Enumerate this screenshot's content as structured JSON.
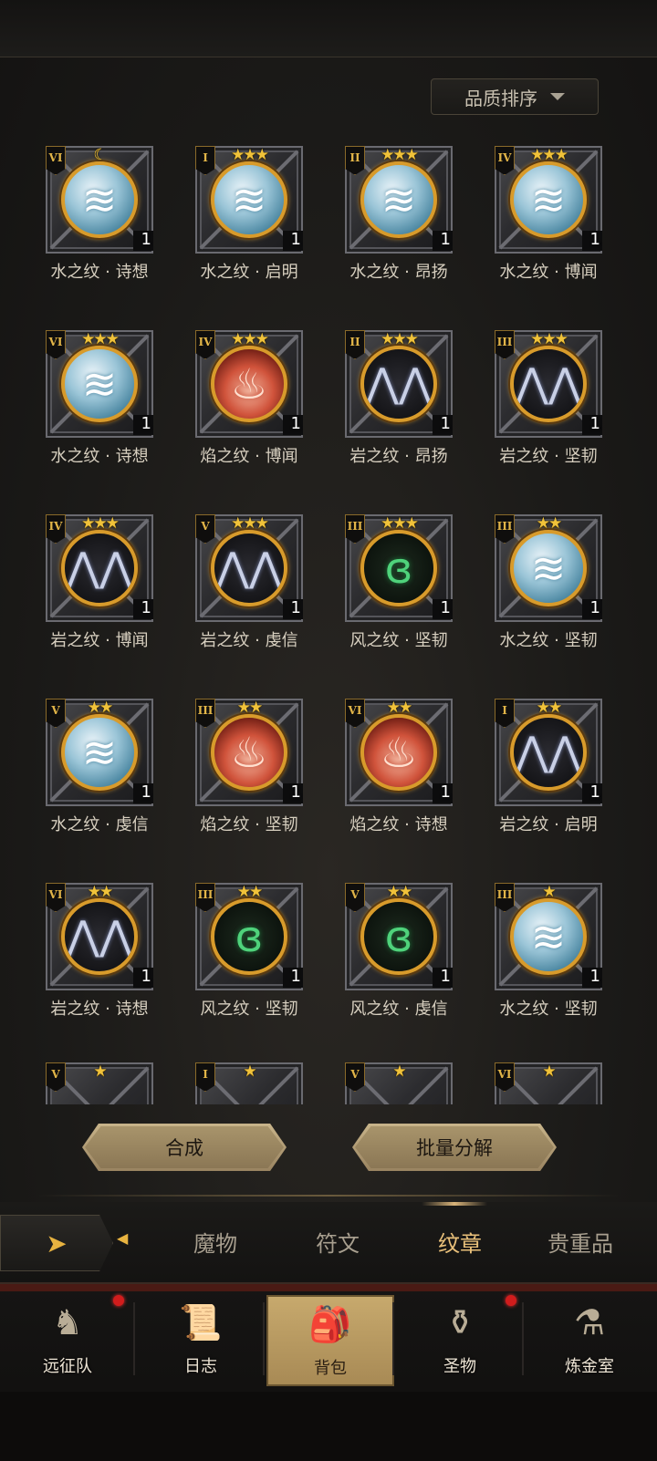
{
  "sort_button": {
    "label": "品质排序"
  },
  "items": [
    {
      "tier": "VI",
      "stars": "☾",
      "element": "water",
      "name": "水之纹 · 诗想",
      "count": "1"
    },
    {
      "tier": "I",
      "stars": "★★★",
      "element": "water",
      "name": "水之纹 · 启明",
      "count": "1"
    },
    {
      "tier": "II",
      "stars": "★★★",
      "element": "water",
      "name": "水之纹 · 昂扬",
      "count": "1"
    },
    {
      "tier": "IV",
      "stars": "★★★",
      "element": "water",
      "name": "水之纹 · 博闻",
      "count": "1"
    },
    {
      "tier": "VI",
      "stars": "★★★",
      "element": "water",
      "name": "水之纹 · 诗想",
      "count": "1"
    },
    {
      "tier": "IV",
      "stars": "★★★",
      "element": "flame",
      "name": "焰之纹 · 博闻",
      "count": "1"
    },
    {
      "tier": "II",
      "stars": "★★★",
      "element": "rock",
      "name": "岩之纹 · 昂扬",
      "count": "1"
    },
    {
      "tier": "III",
      "stars": "★★★",
      "element": "rock",
      "name": "岩之纹 · 坚韧",
      "count": "1"
    },
    {
      "tier": "IV",
      "stars": "★★★",
      "element": "rock",
      "name": "岩之纹 · 博闻",
      "count": "1"
    },
    {
      "tier": "V",
      "stars": "★★★",
      "element": "rock",
      "name": "岩之纹 · 虔信",
      "count": "1"
    },
    {
      "tier": "III",
      "stars": "★★★",
      "element": "wind",
      "name": "风之纹 · 坚韧",
      "count": "1"
    },
    {
      "tier": "III",
      "stars": "★★",
      "element": "water",
      "name": "水之纹 · 坚韧",
      "count": "1"
    },
    {
      "tier": "V",
      "stars": "★★",
      "element": "water",
      "name": "水之纹 · 虔信",
      "count": "1"
    },
    {
      "tier": "III",
      "stars": "★★",
      "element": "flame",
      "name": "焰之纹 · 坚韧",
      "count": "1"
    },
    {
      "tier": "VI",
      "stars": "★★",
      "element": "flame",
      "name": "焰之纹 · 诗想",
      "count": "1"
    },
    {
      "tier": "I",
      "stars": "★★",
      "element": "rock",
      "name": "岩之纹 · 启明",
      "count": "1"
    },
    {
      "tier": "VI",
      "stars": "★★",
      "element": "rock",
      "name": "岩之纹 · 诗想",
      "count": "1"
    },
    {
      "tier": "III",
      "stars": "★★",
      "element": "wind",
      "name": "风之纹 · 坚韧",
      "count": "1"
    },
    {
      "tier": "V",
      "stars": "★★",
      "element": "wind",
      "name": "风之纹 · 虔信",
      "count": "1"
    },
    {
      "tier": "III",
      "stars": "★",
      "element": "water",
      "name": "水之纹 · 坚韧",
      "count": "1"
    }
  ],
  "partial_items": [
    {
      "tier": "V",
      "stars": "★"
    },
    {
      "tier": "I",
      "stars": "★"
    },
    {
      "tier": "V",
      "stars": "★"
    },
    {
      "tier": "VI",
      "stars": "★"
    }
  ],
  "glyphs": {
    "water": "≋",
    "flame": "♨",
    "rock": "⋀⋀",
    "wind": "ɞ"
  },
  "actions": {
    "compose": "合成",
    "batch_decompose": "批量分解"
  },
  "tabs": [
    {
      "label": "魔物",
      "active": false
    },
    {
      "label": "符文",
      "active": false
    },
    {
      "label": "纹章",
      "active": true
    },
    {
      "label": "贵重品",
      "active": false
    }
  ],
  "nav": [
    {
      "label": "远征队",
      "icon": "viking-helmet-icon",
      "glyph": "♞",
      "badge": true,
      "active": false
    },
    {
      "label": "日志",
      "icon": "journal-scroll-icon",
      "glyph": "📜",
      "badge": false,
      "active": false
    },
    {
      "label": "背包",
      "icon": "backpack-icon",
      "glyph": "🎒",
      "badge": false,
      "active": true
    },
    {
      "label": "圣物",
      "icon": "chalice-icon",
      "glyph": "⚱",
      "badge": true,
      "active": false
    },
    {
      "label": "炼金室",
      "icon": "alchemy-icon",
      "glyph": "⚗",
      "badge": false,
      "active": false
    }
  ],
  "colors": {
    "accent_gold": "#e8b340",
    "badge_red": "#d11c1c"
  }
}
